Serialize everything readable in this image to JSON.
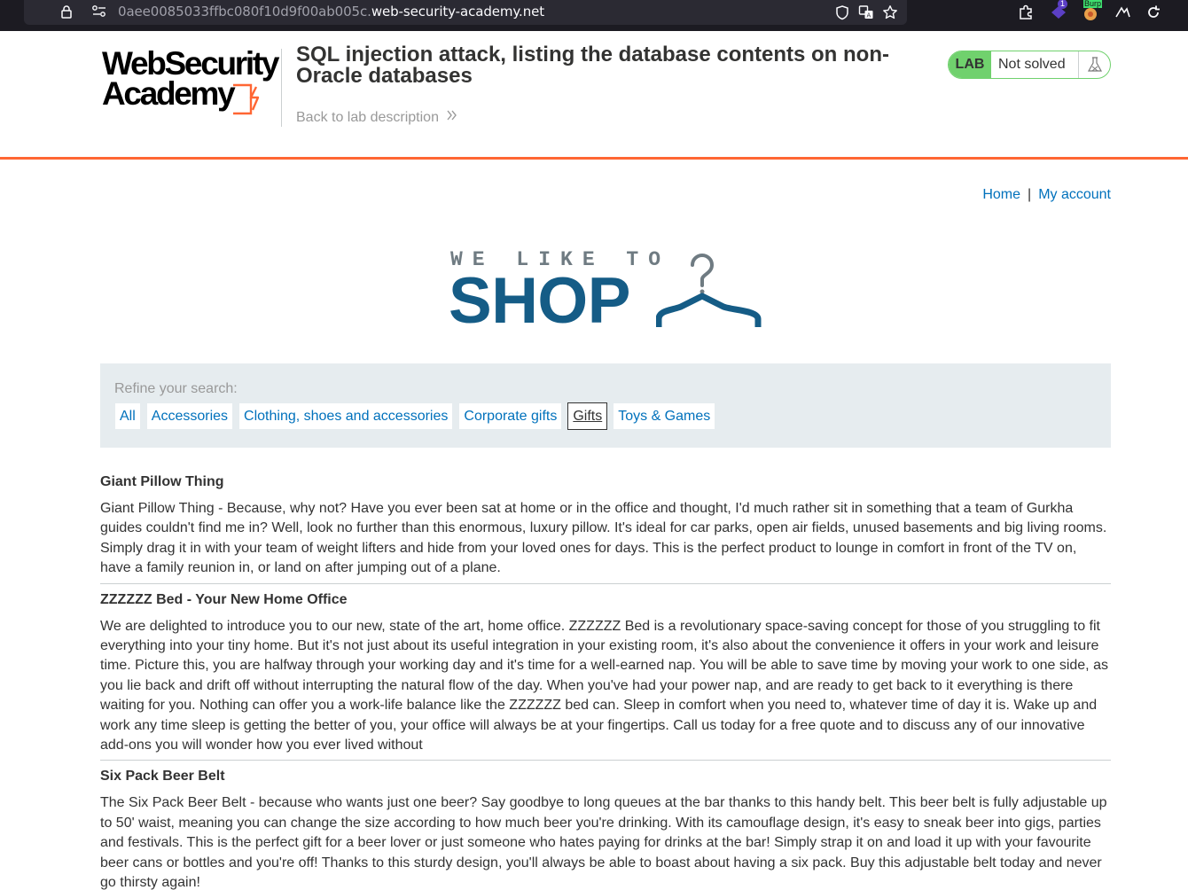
{
  "browser": {
    "url_subdomain": "0aee0085033ffbc080f10d9f00ab005c.",
    "url_domain": "web-security-academy.net",
    "extension_badge": "1",
    "extension_label": "Burp"
  },
  "academy": {
    "logo_line1": "WebSecurity",
    "logo_line2": "Academy",
    "lab_title": "SQL injection attack, listing the database contents on non-Oracle databases",
    "back_link": "Back to lab description",
    "lab_badge": "LAB",
    "lab_status": "Not solved",
    "colors": {
      "accent": "#ff6633",
      "badge": "#70d16d",
      "link": "#0071bc"
    }
  },
  "shop_nav": {
    "home": "Home",
    "separator": "|",
    "my_account": "My account"
  },
  "shop_logo": {
    "tagline": "WE LIKE TO",
    "word": "SHOP"
  },
  "filters": {
    "label": "Refine your search:",
    "items": [
      {
        "label": "All",
        "active": false
      },
      {
        "label": "Accessories",
        "active": false
      },
      {
        "label": "Clothing, shoes and accessories",
        "active": false
      },
      {
        "label": "Corporate gifts",
        "active": false
      },
      {
        "label": "Gifts",
        "active": true
      },
      {
        "label": "Toys & Games",
        "active": false
      }
    ]
  },
  "products": [
    {
      "name": "Giant Pillow Thing",
      "description": "Giant Pillow Thing - Because, why not? Have you ever been sat at home or in the office and thought, I'd much rather sit in something that a team of Gurkha guides couldn't find me in? Well, look no further than this enormous, luxury pillow. It's ideal for car parks, open air fields, unused basements and big living rooms. Simply drag it in with your team of weight lifters and hide from your loved ones for days. This is the perfect product to lounge in comfort in front of the TV on, have a family reunion in, or land on after jumping out of a plane."
    },
    {
      "name": "ZZZZZZ Bed - Your New Home Office",
      "description": "We are delighted to introduce you to our new, state of the art, home office. ZZZZZZ Bed is a revolutionary space-saving concept for those of you struggling to fit everything into your tiny home. But it's not just about its useful integration in your existing room, it's also about the convenience it offers in your work and leisure time. Picture this, you are halfway through your working day and it's time for a well-earned nap. You will be able to save time by moving your work to one side, as you lie back and drift off without interrupting the natural flow of the day. When you've had your power nap, and are ready to get back to it everything is there waiting for you. Nothing can offer you a work-life balance like the ZZZZZZ bed can. Sleep in comfort when you need to, whatever time of day it is. Wake up and work any time sleep is getting the better of you, your office will always be at your fingertips. Call us today for a free quote and to discuss any of our innovative add-ons you will wonder how you ever lived without"
    },
    {
      "name": "Six Pack Beer Belt",
      "description": "The Six Pack Beer Belt - because who wants just one beer? Say goodbye to long queues at the bar thanks to this handy belt. This beer belt is fully adjustable up to 50' waist, meaning you can change the size according to how much beer you're drinking. With its camouflage design, it's easy to sneak beer into gigs, parties and festivals. This is the perfect gift for a beer lover or just someone who hates paying for drinks at the bar! Simply strap it on and load it up with your favourite beer cans or bottles and you're off! Thanks to this sturdy design, you'll always be able to boast about having a six pack. Buy this adjustable belt today and never go thirsty again!"
    }
  ]
}
